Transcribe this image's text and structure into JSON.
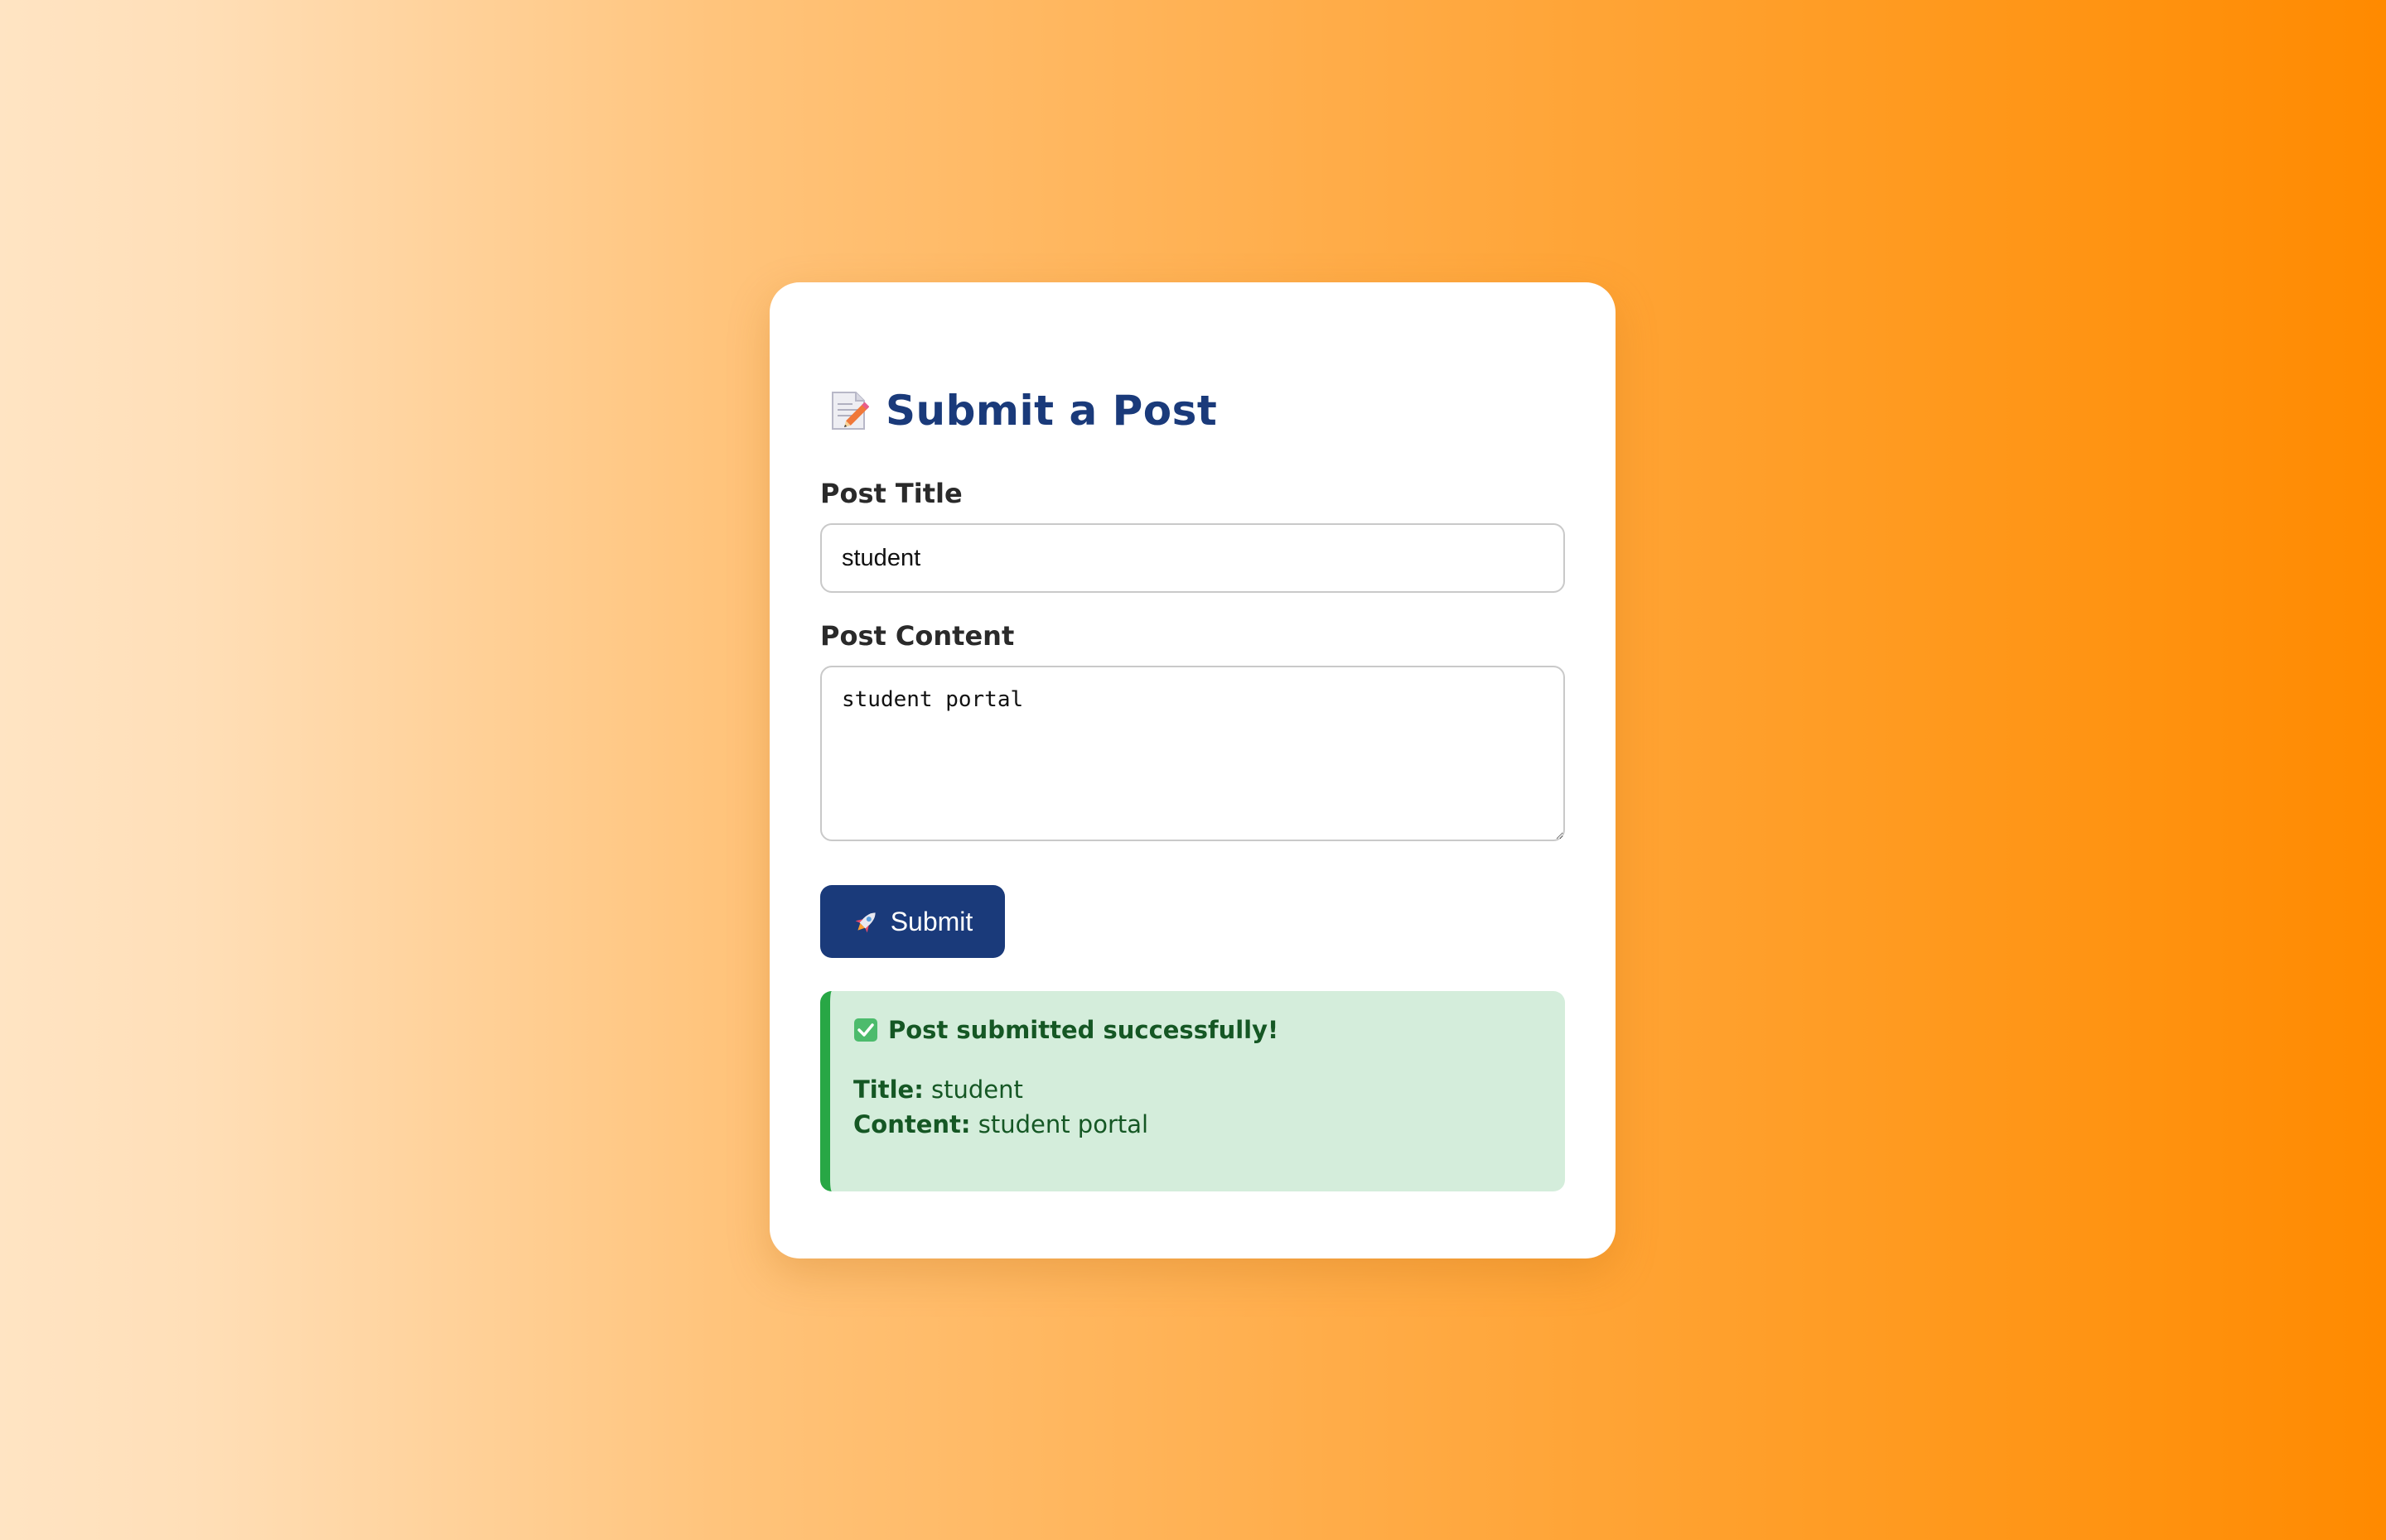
{
  "form": {
    "heading": "Submit a Post",
    "heading_icon": "memo-icon",
    "title_label": "Post Title",
    "title_value": "student",
    "content_label": "Post Content",
    "content_value": "student portal",
    "submit_label": "Submit",
    "submit_icon": "rocket-icon"
  },
  "result": {
    "icon": "check-mark-button-icon",
    "message": "Post submitted successfully!",
    "title_key": "Title:",
    "title_value": "student",
    "content_key": "Content:",
    "content_value": "student portal"
  },
  "colors": {
    "accent": "#1a3a7a",
    "success_bg": "#d4eddb",
    "success_border": "#28a745",
    "success_text": "#155724",
    "background_start": "#ffe4c3",
    "background_end": "#ff8a00"
  }
}
